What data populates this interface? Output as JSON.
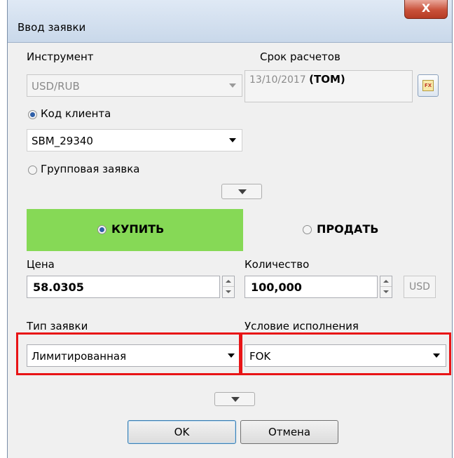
{
  "window": {
    "title": "Ввод заявки",
    "close_label": "X"
  },
  "instrument": {
    "label": "Инструмент",
    "value": "USD/RUB"
  },
  "settlement": {
    "label": "Срок расчетов",
    "date": "13/10/2017",
    "code": "(TOM)",
    "calendar_icon_text": "FX"
  },
  "client": {
    "radio_label": "Код клиента",
    "value": "SBM_29340",
    "group_radio_label": "Групповая заявка"
  },
  "side": {
    "buy_label": "КУПИТЬ",
    "sell_label": "ПРОДАТЬ",
    "buy_color": "#86d956"
  },
  "price": {
    "label": "Цена",
    "value": "58.0305"
  },
  "quantity": {
    "label": "Количество",
    "value": "100,000",
    "currency": "USD"
  },
  "order_type": {
    "label": "Тип заявки",
    "value": "Лимитированная"
  },
  "execution": {
    "label": "Условие исполнения",
    "value": "FOK"
  },
  "buttons": {
    "ok": "OK",
    "cancel": "Отмена"
  },
  "highlight_color": "#e81416"
}
